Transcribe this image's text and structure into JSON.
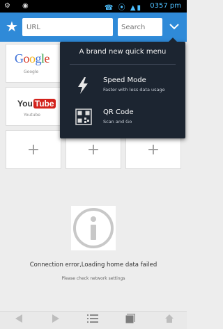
{
  "status_bar": {
    "left_icons": "⚙",
    "left_icons2": "◉",
    "right_icons": "☎ ⦿ ▲▮",
    "time": "0357 pm"
  },
  "toolbar": {
    "url_placeholder": "URL",
    "search_placeholder": "Search"
  },
  "tiles": [
    {
      "type": "google",
      "label": "Google"
    },
    {
      "type": "youtube",
      "label": "Youtube",
      "logo_you": "You",
      "logo_tube": "Tube"
    },
    {
      "type": "add"
    },
    {
      "type": "add"
    },
    {
      "type": "add"
    }
  ],
  "plus_symbol": "+",
  "logo_google": "Google",
  "popup": {
    "title": "A brand new quick menu",
    "items": [
      {
        "icon": "lightning-icon",
        "title": "Speed Mode",
        "desc": "Faster with less data usage"
      },
      {
        "icon": "qr-code-icon",
        "title": "QR Code",
        "desc": "Scan and Go"
      }
    ]
  },
  "error": {
    "title": "Connection error,Loading home data failed",
    "subtitle": "Please check network settings"
  },
  "colors": {
    "toolbar": "#2f8ad8",
    "popup": "#1c2531",
    "background": "#ededed"
  }
}
